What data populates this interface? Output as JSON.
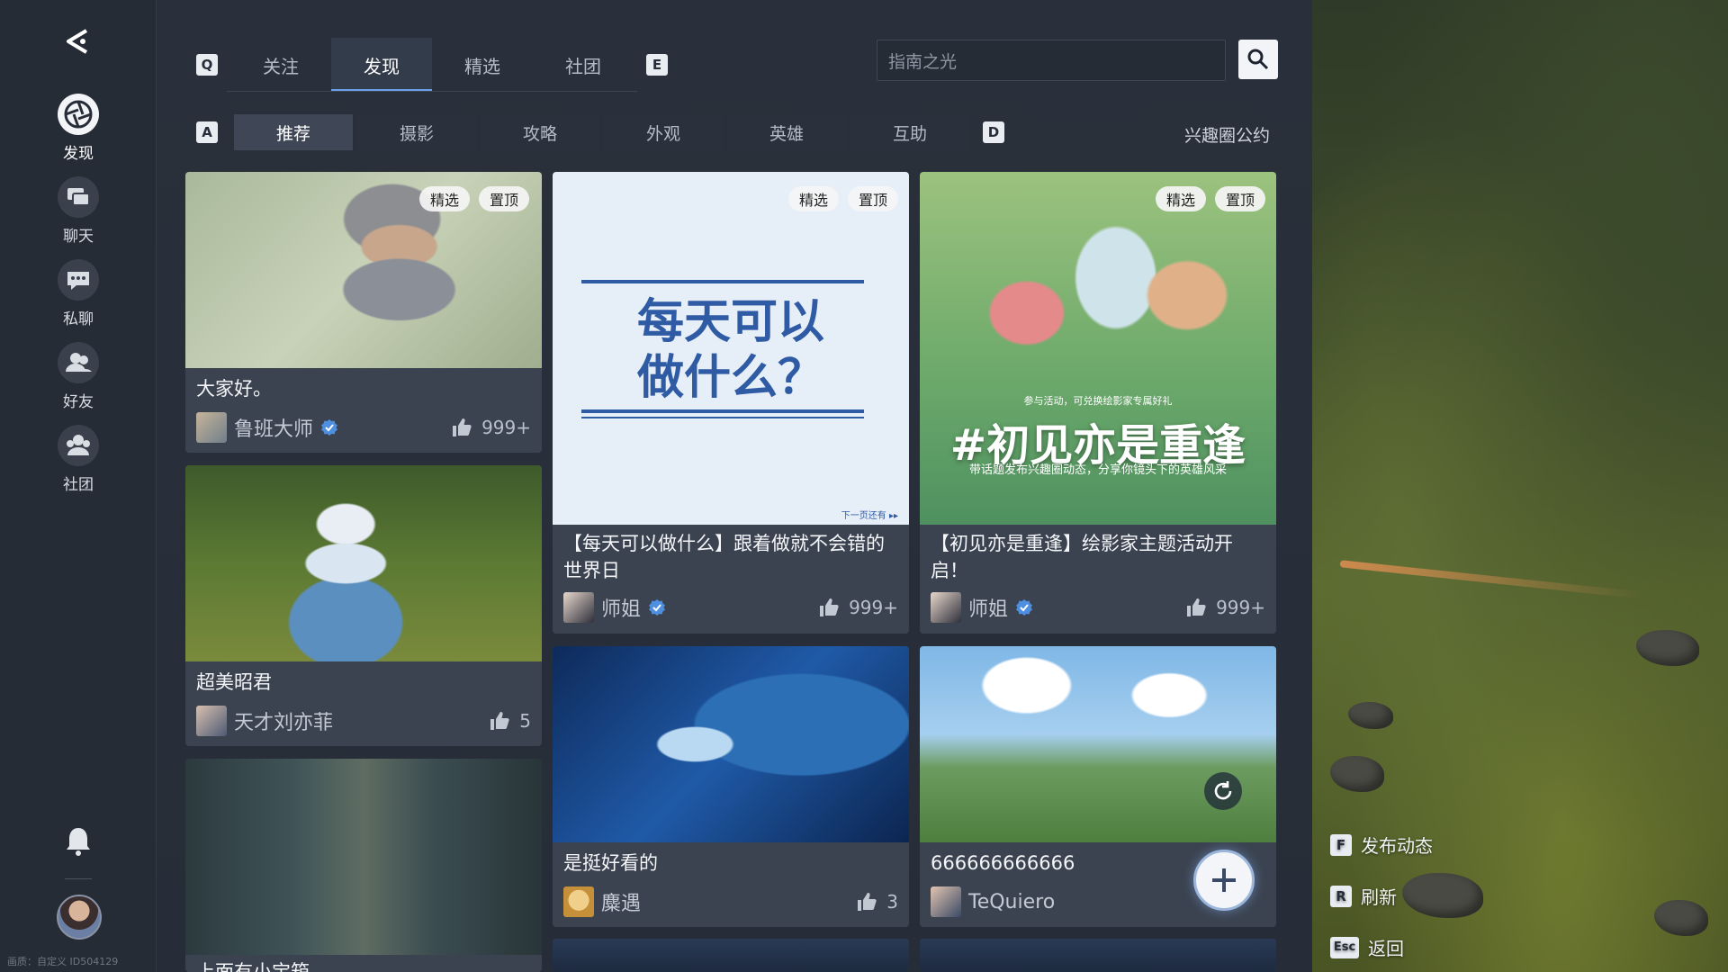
{
  "nav": {
    "items": [
      {
        "label": "发现",
        "icon": "aperture-icon"
      },
      {
        "label": "聊天",
        "icon": "chat-icon"
      },
      {
        "label": "私聊",
        "icon": "message-icon"
      },
      {
        "label": "好友",
        "icon": "friends-icon"
      },
      {
        "label": "社团",
        "icon": "club-icon"
      }
    ],
    "watermark": "画质：自定义 ID504129"
  },
  "top_tabs": {
    "left_key": "Q",
    "right_key": "E",
    "tabs": [
      "关注",
      "发现",
      "精选",
      "社团"
    ],
    "active": "发现"
  },
  "search": {
    "value": "指南之光"
  },
  "sub_tabs": {
    "left_key": "A",
    "right_key": "D",
    "tabs": [
      "推荐",
      "摄影",
      "攻略",
      "外观",
      "英雄",
      "互助"
    ],
    "active": "推荐",
    "rules_link": "兴趣圈公约"
  },
  "cards": [
    {
      "title": "大家好。",
      "author": "鲁班大师",
      "verified": true,
      "likes": "999+",
      "badges": [
        "精选",
        "置顶"
      ]
    },
    {
      "title": "超美昭君",
      "author": "天才刘亦菲",
      "verified": false,
      "likes": "5",
      "badges": []
    },
    {
      "title": "上面有小宝箱",
      "author": "",
      "verified": false,
      "likes": "",
      "badges": []
    },
    {
      "title": "【每天可以做什么】跟着做就不会错的世界日",
      "author": "师姐",
      "verified": true,
      "likes": "999+",
      "badges": [
        "精选",
        "置顶"
      ],
      "image_text": {
        "line1": "每天可以",
        "line2": "做什么？",
        "footer": "下一页还有 ▸▸"
      }
    },
    {
      "title": "是挺好看的",
      "author": "麋遇",
      "verified": false,
      "likes": "3",
      "badges": []
    },
    {
      "title": "【初见亦是重逢】绘影家主题活动开启！",
      "author": "师姐",
      "verified": true,
      "likes": "999+",
      "badges": [
        "精选",
        "置顶"
      ],
      "image_text": {
        "note": "参与活动，可兑换绘影家专属好礼",
        "tag": "#初见亦是重逢",
        "sub": "带话题发布兴趣圈动态，分享你镜头下的英雄风采"
      }
    },
    {
      "title": "666666666666",
      "author": "TeQuiero",
      "verified": false,
      "likes": "",
      "badges": []
    }
  ],
  "hotkeys": [
    {
      "key": "F",
      "label": "发布动态"
    },
    {
      "key": "R",
      "label": "刷新"
    },
    {
      "key": "Esc",
      "label": "返回"
    }
  ],
  "colors": {
    "accent": "#6ca1ea",
    "verified": "#4e8fe0",
    "panel": "#272d38",
    "card": "#3b4350"
  }
}
